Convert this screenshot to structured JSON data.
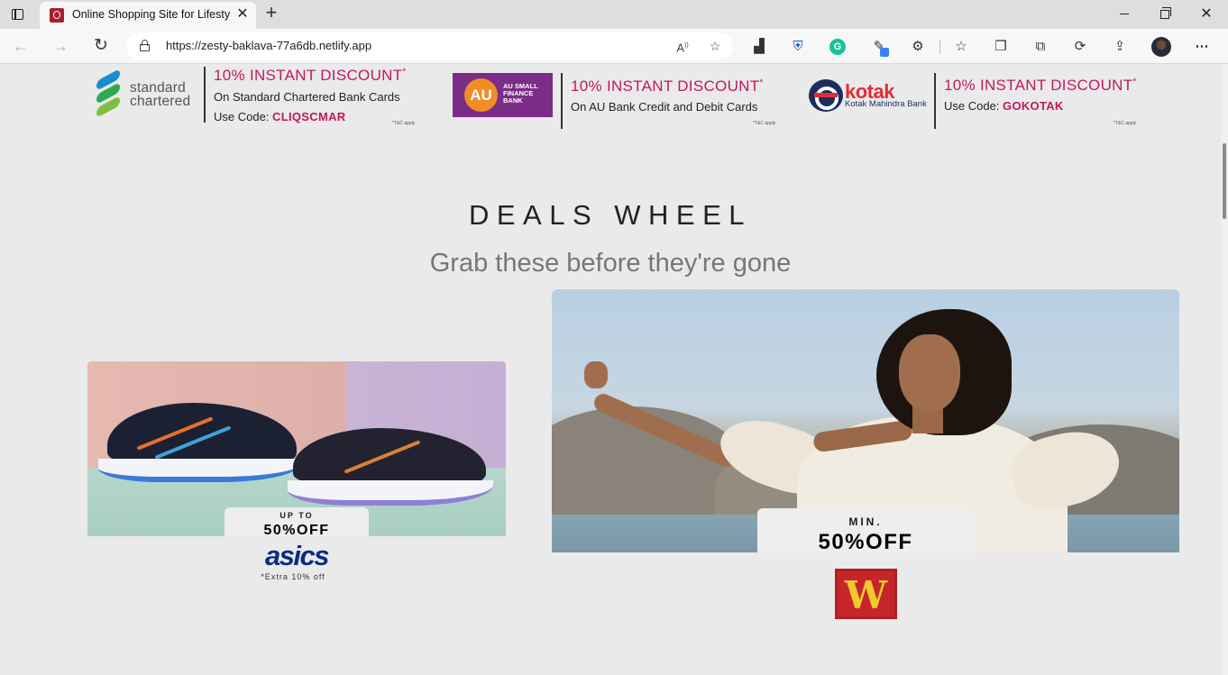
{
  "browser": {
    "tab_title": "Online Shopping Site for Lifestyle",
    "tab_close": "✕",
    "new_tab": "+",
    "url": "https://zesty-baklava-77a6db.netlify.app",
    "read_aloud": "A",
    "window_close": "✕"
  },
  "offers": [
    {
      "bank_logo_text": "standard chartered",
      "headline": "10% INSTANT DISCOUNT",
      "asterisk": "*",
      "description": "On Standard Chartered Bank Cards",
      "code_prefix": "Use Code: ",
      "code": "CLIQSCMAR",
      "tc": "*T&C apply"
    },
    {
      "bank_logo_mark": "AU",
      "bank_logo_text": "AU SMALL FINANCE BANK",
      "headline": "10% INSTANT DISCOUNT",
      "asterisk": "*",
      "description": "On AU Bank Credit and Debit Cards",
      "tc": "*T&C apply"
    },
    {
      "bank_logo_text": "kotak",
      "bank_logo_subtext": "Kotak Mahindra Bank",
      "headline": "10% INSTANT DISCOUNT",
      "asterisk": "*",
      "code_prefix": "Use Code: ",
      "code": "GOKOTAK",
      "tc": "*T&C apply"
    }
  ],
  "deals": {
    "title": "DEALS WHEEL",
    "subtitle": "Grab these before they're gone",
    "cards": [
      {
        "prefix": "UP TO",
        "discount": "50%OFF",
        "brand": "asics",
        "note": "*Extra 10% off"
      },
      {
        "prefix": "MIN.",
        "discount": "50%OFF",
        "brand_glyph": "W"
      }
    ]
  }
}
